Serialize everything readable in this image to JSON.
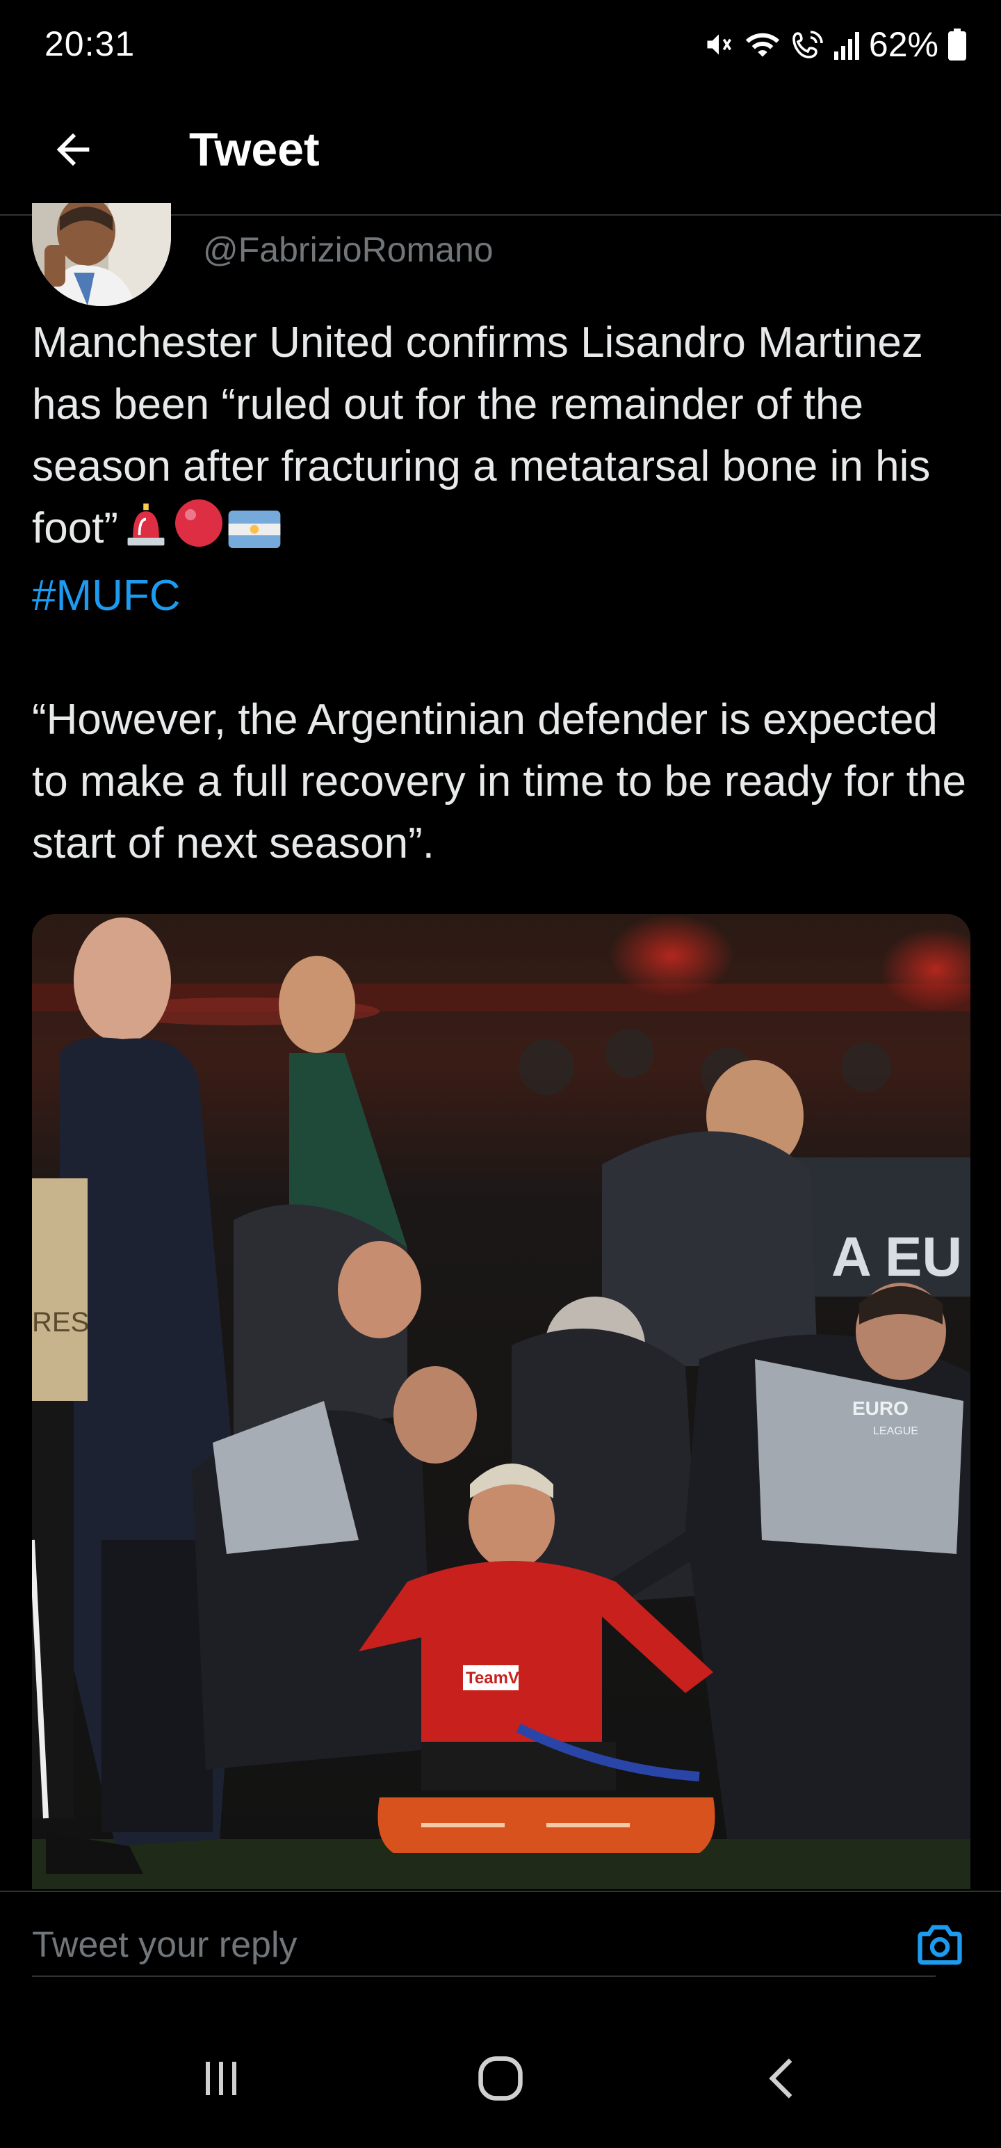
{
  "status_bar": {
    "time": "20:31",
    "battery": "62%",
    "icons": [
      "mute-icon",
      "wifi-icon",
      "wifi-calling-icon",
      "signal-icon",
      "battery-icon"
    ]
  },
  "header": {
    "back_icon": "arrow-left-icon",
    "title": "Tweet"
  },
  "tweet": {
    "handle": "@FabrizioRomano",
    "text_line1": "Manchester United confirms Lisandro Martinez has been “ruled out for the remainder of the season after fracturing a metatarsal bone in his foot”",
    "emojis": [
      "rotating-light-icon",
      "red-circle-icon",
      "argentina-flag-icon"
    ],
    "hashtag": "#MUFC",
    "text_quote": "“However, the Argentinian defender is expected to make a full recovery in time to be ready for the start of next season”.",
    "photo": {
      "visible_text": [
        "A EU",
        "EURO",
        "LEAGUE",
        "RES",
        "TeamVie"
      ]
    }
  },
  "reply": {
    "placeholder": "Tweet your reply",
    "camera_icon": "camera-icon"
  },
  "nav": {
    "icons": [
      "recent-apps-icon",
      "home-icon",
      "back-icon"
    ]
  },
  "colors": {
    "accent": "#1d9bf0",
    "background": "#000000",
    "text": "#e7e9ea",
    "muted": "#71767b",
    "divider": "#2f3336"
  }
}
